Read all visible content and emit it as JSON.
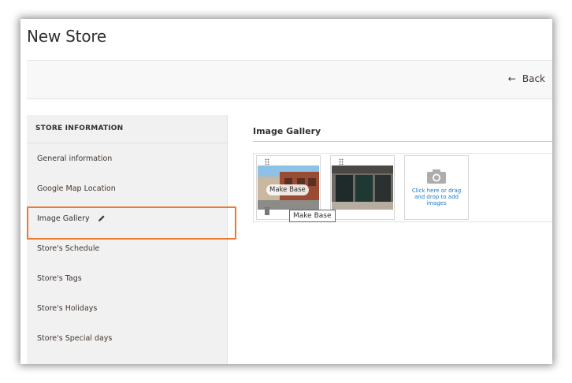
{
  "page": {
    "title": "New Store"
  },
  "toolbar": {
    "back_label": "Back"
  },
  "sidebar": {
    "header": "STORE INFORMATION",
    "items": [
      {
        "label": "General information"
      },
      {
        "label": "Google Map Location"
      },
      {
        "label": "Image Gallery"
      },
      {
        "label": "Store's Schedule"
      },
      {
        "label": "Store's Tags"
      },
      {
        "label": "Store's Holidays"
      },
      {
        "label": "Store's Special days"
      }
    ]
  },
  "gallery": {
    "title": "Image Gallery",
    "make_base_label": "Make Base",
    "tooltip": "Make Base",
    "upload_text": "Click here or drag and drop to add images"
  },
  "colors": {
    "highlight": "#eb7b30",
    "link": "#1979c3",
    "sidebar_bg": "#f1f1f1"
  },
  "icons": [
    "back-arrow-icon",
    "pencil-icon",
    "drag-handle-icon",
    "trash-icon",
    "camera-icon"
  ]
}
